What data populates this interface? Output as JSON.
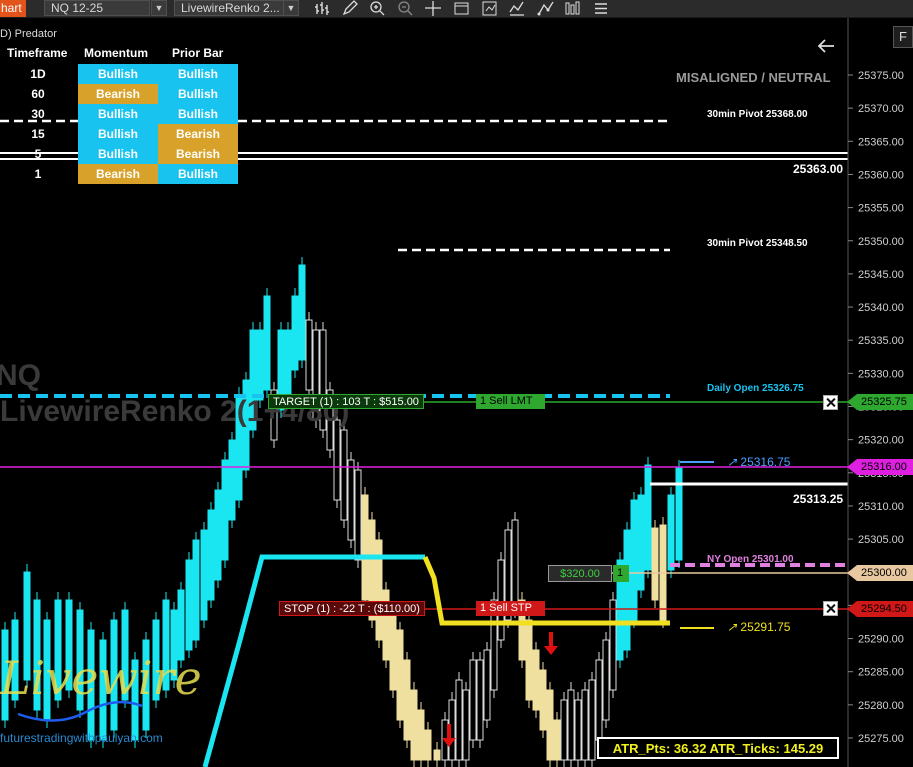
{
  "toolbar": {
    "chart_tab": "hart",
    "instrument": "NQ 12-25",
    "chart_type": "LivewireRenko 2...",
    "icons": [
      "bar-style-icon",
      "draw-pencil-icon",
      "zoom-in-icon",
      "zoom-out-icon",
      "crosshair-icon",
      "templates-icon",
      "strategies-icon",
      "indicators-icon",
      "properties-icon"
    ]
  },
  "indicator_title": "D) Predator",
  "status_text": "MISALIGNED / NEUTRAL",
  "watermark": {
    "line1": "NQ",
    "line2": "LivewireRenko 2(1+4/80)"
  },
  "brand": {
    "name": "Livewire",
    "url": "futurestradingwithpaulyan.com"
  },
  "momentum_table": {
    "headers": [
      "Timeframe",
      "Momentum",
      "Prior Bar"
    ],
    "rows": [
      {
        "tf": "1D",
        "momentum": "Bullish",
        "prior": "Bullish"
      },
      {
        "tf": "60",
        "momentum": "Bearish",
        "prior": "Bullish"
      },
      {
        "tf": "30",
        "momentum": "Bullish",
        "prior": "Bullish"
      },
      {
        "tf": "15",
        "momentum": "Bullish",
        "prior": "Bearish"
      },
      {
        "tf": "5",
        "momentum": "Bullish",
        "prior": "Bearish"
      },
      {
        "tf": "1",
        "momentum": "Bearish",
        "prior": "Bullish"
      }
    ],
    "colors": {
      "Bullish": "#19c3f0",
      "Bearish": "#d8a22a"
    }
  },
  "levels": {
    "pivot_30_high": "30min Pivot 25368.00",
    "pivot_30_low": "30min Pivot 25348.50",
    "daily_open": "Daily Open 25326.75",
    "ny_open": "NY Open 25301.00",
    "level_25363": "25363.00",
    "level_25313": "25313.25",
    "proj_up": "25316.75",
    "proj_down": "25291.75"
  },
  "orders": {
    "target_label": "TARGET (1) : 103 T : $515.00",
    "sell_lmt": "1  Sell LMT",
    "stop_label": "STOP (1) : -22 T : ($110.00)",
    "sell_stp": "1  Sell STP",
    "position_pnl": "$320.00",
    "position_qty": "1"
  },
  "price_tags": {
    "target": "25325.75",
    "current": "25316.00",
    "entry": "25300.00",
    "stop": "25294.50"
  },
  "price_axis": [
    "25375.00",
    "25370.00",
    "25365.00",
    "25360.00",
    "25355.00",
    "25350.00",
    "25345.00",
    "25340.00",
    "25335.00",
    "25330.00",
    "25325.00",
    "25320.00",
    "25315.00",
    "25310.00",
    "25305.00",
    "25300.00",
    "25295.00",
    "25290.00",
    "25285.00",
    "25280.00",
    "25275.00"
  ],
  "atr": "ATR_Pts: 36.32  ATR_Ticks: 145.29",
  "colors": {
    "cyan_bar": "#19e6f0",
    "tan_bar": "#f0e0a0",
    "magenta": "#e020e0",
    "target_green": "#2ea82e",
    "stop_red": "#d01818",
    "yellow_line": "#f0e020"
  }
}
